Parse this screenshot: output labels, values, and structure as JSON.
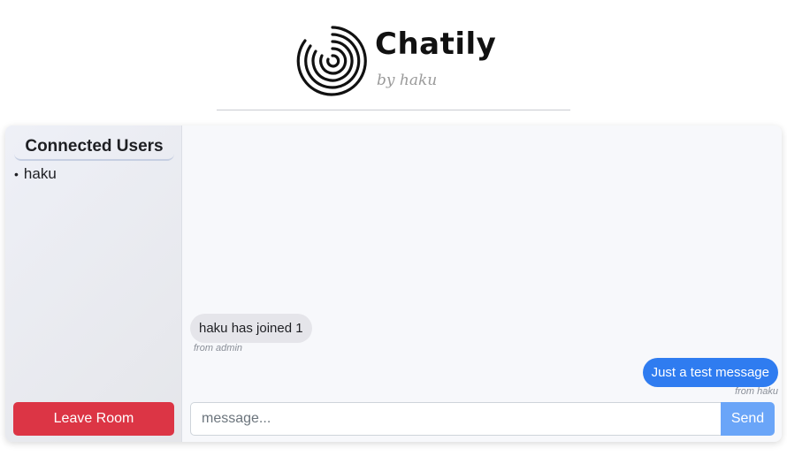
{
  "header": {
    "app_name": "Chatily",
    "byline": "by haku"
  },
  "sidebar": {
    "title": "Connected Users",
    "users": [
      "haku"
    ],
    "leave_label": "Leave Room"
  },
  "chat": {
    "messages": [
      {
        "text": "haku has joined 1",
        "from": "from admin",
        "direction": "incoming"
      },
      {
        "text": "Just a test message",
        "from": "from haku",
        "direction": "outgoing"
      }
    ],
    "input": {
      "value": "",
      "placeholder": "message..."
    },
    "send_label": "Send"
  },
  "colors": {
    "leave_button": "#dc3545",
    "outgoing_bubble": "#2f7cf0",
    "incoming_bubble": "#e5e5ea",
    "send_button": "#6aa5f8"
  },
  "icons": {
    "logo": "concentric-spiral-icon"
  }
}
